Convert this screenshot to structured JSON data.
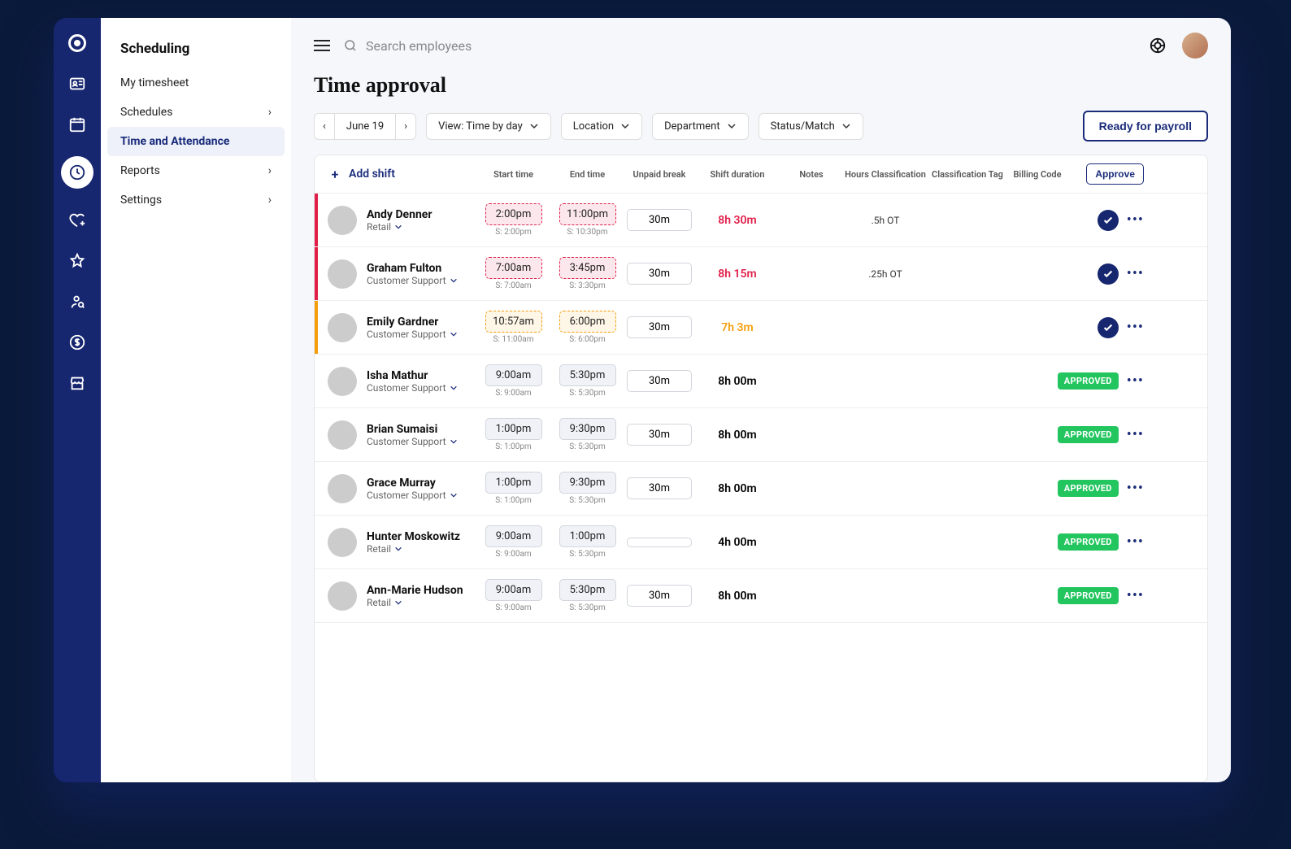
{
  "sidebar": {
    "title": "Scheduling",
    "items": [
      {
        "label": "My timesheet",
        "has_children": false
      },
      {
        "label": "Schedules",
        "has_children": true
      },
      {
        "label": "Time and Attendance",
        "has_children": false,
        "active": true
      },
      {
        "label": "Reports",
        "has_children": true
      },
      {
        "label": "Settings",
        "has_children": true
      }
    ]
  },
  "search": {
    "placeholder": "Search employees"
  },
  "page": {
    "title": "Time approval"
  },
  "toolbar": {
    "date_label": "June 19",
    "view_label": "View: Time by day",
    "location_label": "Location",
    "department_label": "Department",
    "status_label": "Status/Match",
    "ready_label": "Ready for payroll"
  },
  "table": {
    "add_shift_label": "Add shift",
    "headers": {
      "start": "Start time",
      "end": "End time",
      "break": "Unpaid break",
      "duration": "Shift duration",
      "notes": "Notes",
      "hours_class": "Hours Classification",
      "class_tag": "Classification Tag",
      "billing": "Billing Code",
      "approve": "Approve"
    },
    "rows": [
      {
        "name": "Andy Denner",
        "dept": "Retail",
        "start": "2:00pm",
        "s_start": "2:00pm",
        "end": "11:00pm",
        "s_end": "10:30pm",
        "break": "30m",
        "duration": "8h 30m",
        "hc": ".5h OT",
        "status": "pending",
        "variant": "err",
        "av": "av1"
      },
      {
        "name": "Graham Fulton",
        "dept": "Customer Support",
        "start": "7:00am",
        "s_start": "7:00am",
        "end": "3:45pm",
        "s_end": "3:30pm",
        "break": "30m",
        "duration": "8h 15m",
        "hc": ".25h OT",
        "status": "pending",
        "variant": "err",
        "av": "av2"
      },
      {
        "name": "Emily Gardner",
        "dept": "Customer Support",
        "start": "10:57am",
        "s_start": "11:00am",
        "end": "6:00pm",
        "s_end": "6:00pm",
        "break": "30m",
        "duration": "7h 3m",
        "hc": "",
        "status": "pending",
        "variant": "warn",
        "av": "av3"
      },
      {
        "name": "Isha Mathur",
        "dept": "Customer Support",
        "start": "9:00am",
        "s_start": "9:00am",
        "end": "5:30pm",
        "s_end": "5:30pm",
        "break": "30m",
        "duration": "8h 00m",
        "hc": "",
        "status": "approved",
        "variant": "",
        "av": "av4"
      },
      {
        "name": "Brian Sumaisi",
        "dept": "Customer Support",
        "start": "1:00pm",
        "s_start": "1:00pm",
        "end": "9:30pm",
        "s_end": "5:30pm",
        "break": "30m",
        "duration": "8h 00m",
        "hc": "",
        "status": "approved",
        "variant": "",
        "av": "av5"
      },
      {
        "name": "Grace Murray",
        "dept": "Customer Support",
        "start": "1:00pm",
        "s_start": "1:00pm",
        "end": "9:30pm",
        "s_end": "5:30pm",
        "break": "30m",
        "duration": "8h 00m",
        "hc": "",
        "status": "approved",
        "variant": "",
        "av": "av6"
      },
      {
        "name": "Hunter Moskowitz",
        "dept": "Retail",
        "start": "9:00am",
        "s_start": "9:00am",
        "end": "1:00pm",
        "s_end": "5:30pm",
        "break": "",
        "duration": "4h 00m",
        "hc": "",
        "status": "approved",
        "variant": "",
        "av": "av7"
      },
      {
        "name": "Ann-Marie Hudson",
        "dept": "Retail",
        "start": "9:00am",
        "s_start": "9:00am",
        "end": "5:30pm",
        "s_end": "5:30pm",
        "break": "30m",
        "duration": "8h 00m",
        "hc": "",
        "status": "approved",
        "variant": "",
        "av": "av8"
      }
    ],
    "approved_label": "APPROVED"
  }
}
